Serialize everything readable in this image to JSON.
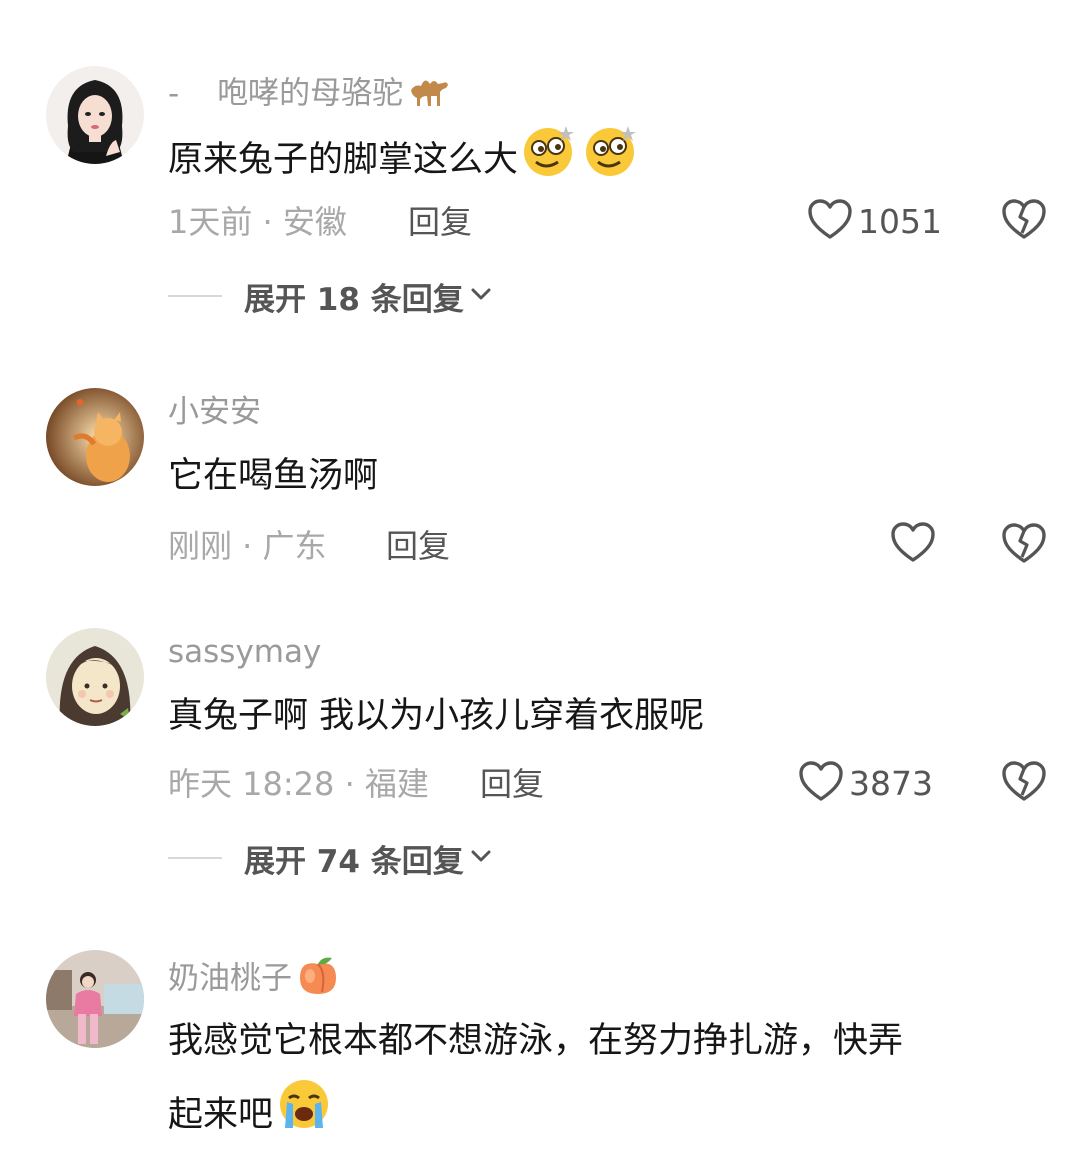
{
  "comments": [
    {
      "username_prefix": "-",
      "username": "咆哮的母骆驼",
      "username_emoji": "camel-emoji",
      "text": "原来兔子的脚掌这么大",
      "text_emojis": [
        "woozy-face-emoji",
        "woozy-face-emoji"
      ],
      "meta": "1天前 · 安徽",
      "reply_label": "回复",
      "likes": "1051",
      "expand_label": "展开 18 条回复"
    },
    {
      "username": "小安安",
      "text": "它在喝鱼汤啊",
      "meta": "刚刚 · 广东",
      "reply_label": "回复",
      "likes": ""
    },
    {
      "username": "sassymay",
      "text": "真兔子啊 我以为小孩儿穿着衣服呢",
      "meta": "昨天 18:28 · 福建",
      "reply_label": "回复",
      "likes": "3873",
      "expand_label": "展开 74 条回复"
    },
    {
      "username": "奶油桃子",
      "username_emoji": "peach-emoji",
      "text_line1": "我感觉它根本都不想游泳，在努力挣扎游，快弄",
      "text_line2": "起来吧",
      "text_emoji": "loudly-crying-face-emoji"
    }
  ],
  "colors": {
    "text": "#161616",
    "muted": "#a8a8a8",
    "secondary": "#555555",
    "background": "#ffffff"
  }
}
